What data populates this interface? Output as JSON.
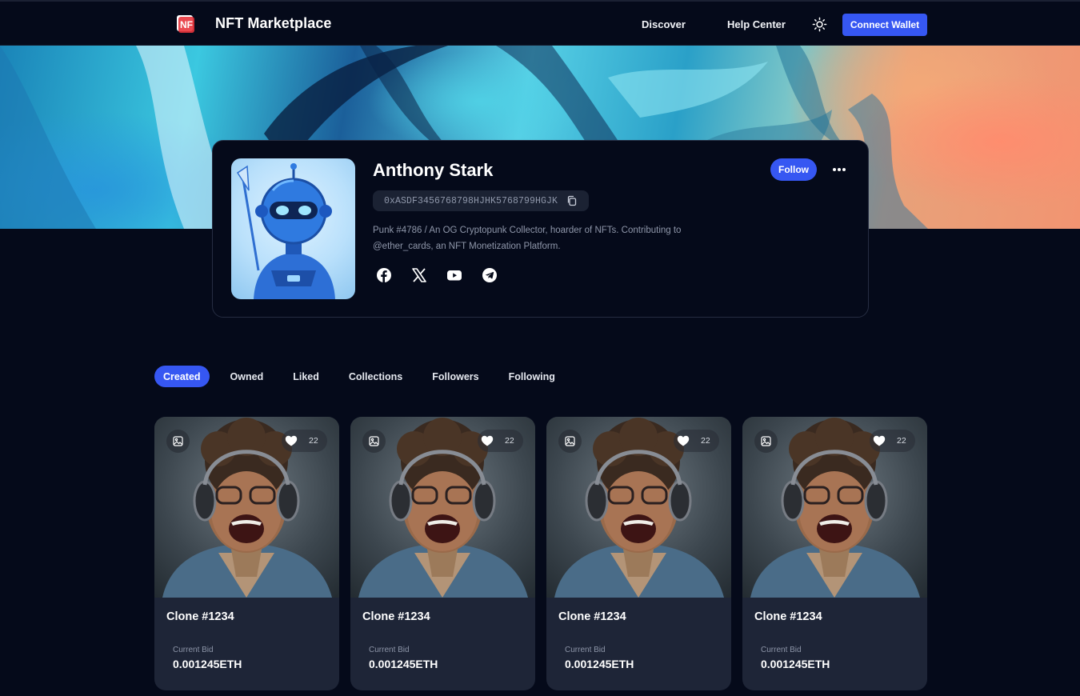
{
  "nav": {
    "brand": "NFT Marketplace",
    "logo_icon": "nft-logo-icon",
    "links": [
      {
        "label": "Discover"
      },
      {
        "label": "Help Center"
      }
    ],
    "theme_icon": "sun-icon",
    "connect_label": "Connect Wallet"
  },
  "profile": {
    "name": "Anthony Stark",
    "wallet": "0xASDF3456768798HJHK5768799HGJK",
    "bio": "Punk #4786 / An OG Cryptopunk Collector, hoarder of NFTs. Contributing to @ether_cards, an NFT Monetization Platform.",
    "follow_label": "Follow",
    "socials": [
      "facebook-icon",
      "x-icon",
      "youtube-icon",
      "telegram-icon"
    ]
  },
  "tabs": [
    {
      "label": "Created",
      "active": true
    },
    {
      "label": "Owned"
    },
    {
      "label": "Liked"
    },
    {
      "label": "Collections"
    },
    {
      "label": "Followers"
    },
    {
      "label": "Following"
    }
  ],
  "cards": [
    {
      "title": "Clone #1234",
      "likes": "22",
      "bid_label": "Current Bid",
      "bid": "0.001245ETH"
    },
    {
      "title": "Clone #1234",
      "likes": "22",
      "bid_label": "Current Bid",
      "bid": "0.001245ETH"
    },
    {
      "title": "Clone #1234",
      "likes": "22",
      "bid_label": "Current Bid",
      "bid": "0.001245ETH"
    },
    {
      "title": "Clone #1234",
      "likes": "22",
      "bid_label": "Current Bid",
      "bid": "0.001245ETH"
    }
  ],
  "colors": {
    "background": "#050a1a",
    "accent": "#3657f2",
    "card": "#1e2537",
    "muted_text": "#8f97aa"
  }
}
